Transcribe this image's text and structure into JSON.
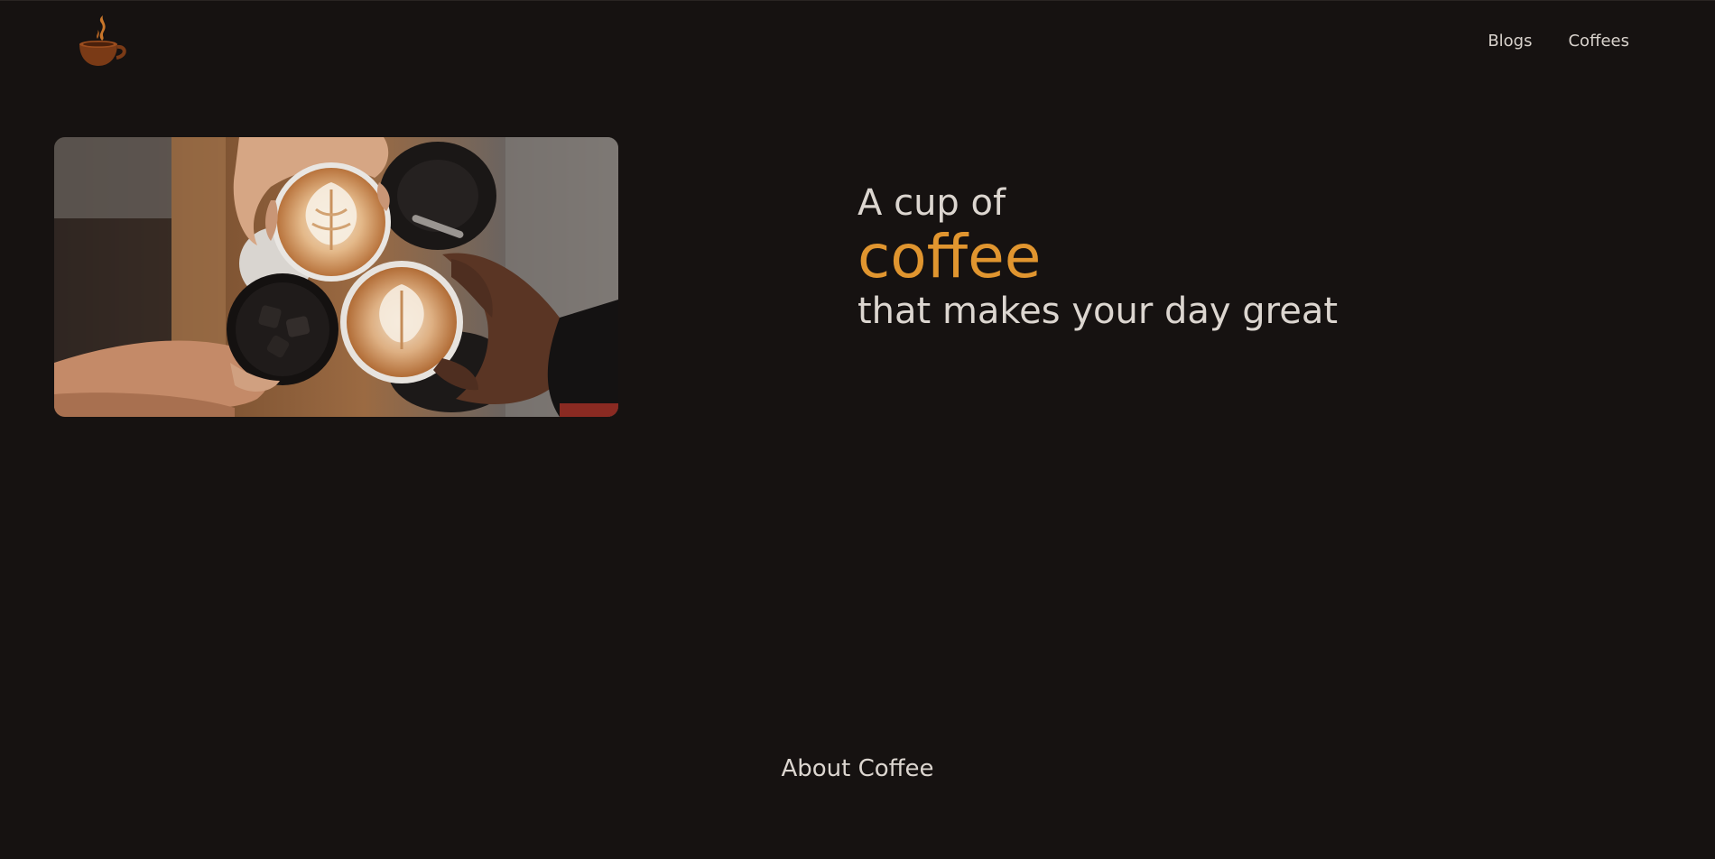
{
  "header": {
    "logo_icon": "coffee-cup-icon",
    "nav": [
      {
        "label": "Blogs"
      },
      {
        "label": "Coffees"
      }
    ]
  },
  "hero": {
    "image_icon": "coffee-cheers-photo",
    "line1": "A cup of",
    "line2": "coffee",
    "line3": "that makes your day great"
  },
  "section": {
    "about_heading": "About Coffee"
  },
  "colors": {
    "background": "#161211",
    "accent": "#e0952f",
    "text": "#dcd6d0"
  }
}
